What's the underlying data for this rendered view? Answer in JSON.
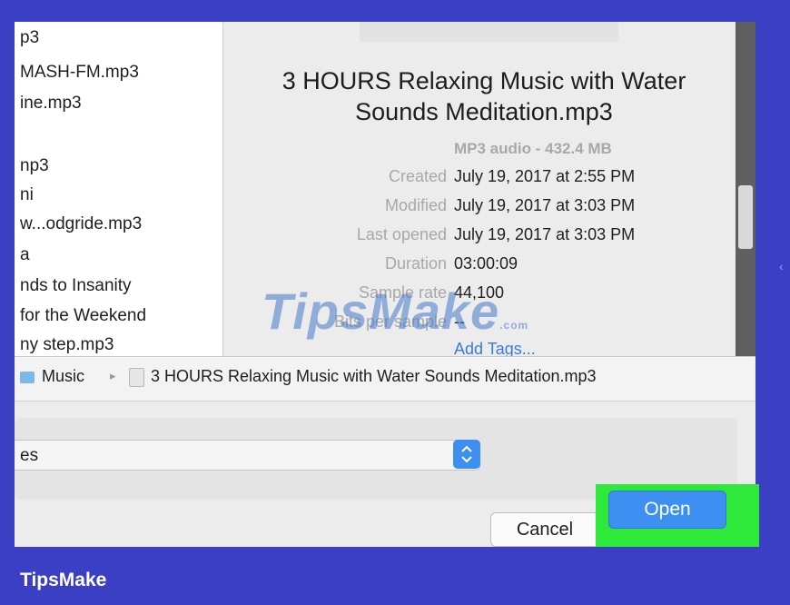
{
  "file_list": {
    "items": [
      "p3",
      "MASH-FM.mp3",
      "ine.mp3",
      "",
      "np3",
      "ni",
      "w...odgride.mp3",
      "a",
      "nds to Insanity",
      " for the Weekend",
      "ny step.mp3"
    ]
  },
  "preview": {
    "title_line1": "3 HOURS Relaxing Music with Water",
    "title_line2": "Sounds Meditation.mp3",
    "kind": "MP3 audio - 432.4 MB",
    "rows": [
      {
        "label": "Created",
        "value": "July 19, 2017 at 2:55 PM"
      },
      {
        "label": "Modified",
        "value": "July 19, 2017 at 3:03 PM"
      },
      {
        "label": "Last opened",
        "value": "July 19, 2017 at 3:03 PM"
      },
      {
        "label": "Duration",
        "value": "03:00:09"
      },
      {
        "label": "Sample rate",
        "value": "44,100"
      },
      {
        "label": "Bits per sample",
        "value": "--"
      }
    ],
    "add_tags": "Add Tags..."
  },
  "pathbar": {
    "folder": "Music",
    "arrow": "▸",
    "file": "3 HOURS Relaxing Music with Water Sounds Meditation.mp3"
  },
  "options": {
    "select_value": "es",
    "select_glyph": "⌃\n⌄"
  },
  "buttons": {
    "cancel": "Cancel",
    "open": "Open"
  },
  "watermark": {
    "text": "TipsMake",
    "suffix": ".com"
  },
  "branding": {
    "label": "TipsMake"
  },
  "colors": {
    "frame": "#3b3fc4",
    "accent": "#3d8ff2",
    "highlight": "#2ee83a"
  }
}
